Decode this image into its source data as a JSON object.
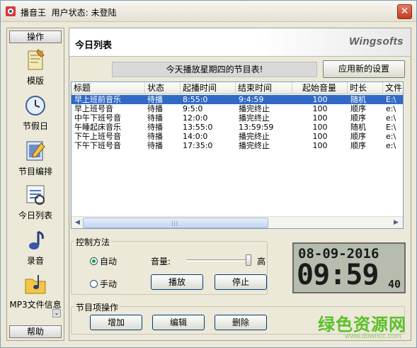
{
  "window": {
    "title": "播音王",
    "user_status_label": "用户状态:",
    "user_status_value": "未登陆",
    "close_label": "✕"
  },
  "sidebar": {
    "header_label": "操作",
    "footer_label": "帮助",
    "items": [
      {
        "label": "模版",
        "icon": "template-icon"
      },
      {
        "label": "节假日",
        "icon": "clock-icon"
      },
      {
        "label": "节目编排",
        "icon": "edit-icon"
      },
      {
        "label": "今日列表",
        "icon": "list-icon"
      },
      {
        "label": "录音",
        "icon": "music-note-icon"
      },
      {
        "label": "MP3文件信息",
        "icon": "folder-music-icon"
      }
    ],
    "scroll_down_label": "⌄"
  },
  "main": {
    "title": "今日列表",
    "brand": "Wingsofts",
    "notice": "今天播放星期四的节目表!",
    "apply_button": "应用新的设置"
  },
  "table": {
    "columns": [
      "标题",
      "状态",
      "起播时间",
      "结束时间",
      "起始音量",
      "时长",
      "文件"
    ],
    "rows": [
      {
        "title": "早上班前音乐",
        "status": "待播",
        "start": "8:55:0",
        "end": "9:4:59",
        "volume": "100",
        "mode": "随机",
        "file": "E:\\"
      },
      {
        "title": "早上班号音",
        "status": "待播",
        "start": "9:5:0",
        "end": "播完终止",
        "volume": "100",
        "mode": "顺序",
        "file": "e:\\"
      },
      {
        "title": "中午下班号音",
        "status": "待播",
        "start": "12:0:0",
        "end": "播完终止",
        "volume": "100",
        "mode": "顺序",
        "file": "e:\\"
      },
      {
        "title": "午睡起床音乐",
        "status": "待播",
        "start": "13:55:0",
        "end": "13:59:59",
        "volume": "100",
        "mode": "随机",
        "file": "E:\\"
      },
      {
        "title": "下午上班号音",
        "status": "待播",
        "start": "14:0:0",
        "end": "播完终止",
        "volume": "100",
        "mode": "顺序",
        "file": "e:\\"
      },
      {
        "title": "下午下班号音",
        "status": "待播",
        "start": "17:35:0",
        "end": "播完终止",
        "volume": "100",
        "mode": "顺序",
        "file": "e:\\"
      }
    ],
    "selected_row": 0,
    "scroll_left": "◀",
    "scroll_right": "▶",
    "scroll_grip": "|||"
  },
  "control": {
    "group_title": "控制方法",
    "auto_label": "自动",
    "manual_label": "手动",
    "auto_selected": true,
    "volume_label": "音量:",
    "volume_max_label": "高",
    "volume_level": 1.0,
    "play_button": "播放",
    "stop_button": "停止"
  },
  "clock": {
    "date": "08-09-2016",
    "time": "09:59",
    "seconds": "40"
  },
  "program_ops": {
    "group_title": "节目项操作",
    "add_button": "增加",
    "edit_button": "编辑",
    "delete_button": "删除"
  },
  "watermark": {
    "text": "绿色资源网",
    "url": "www.downcc.com"
  }
}
